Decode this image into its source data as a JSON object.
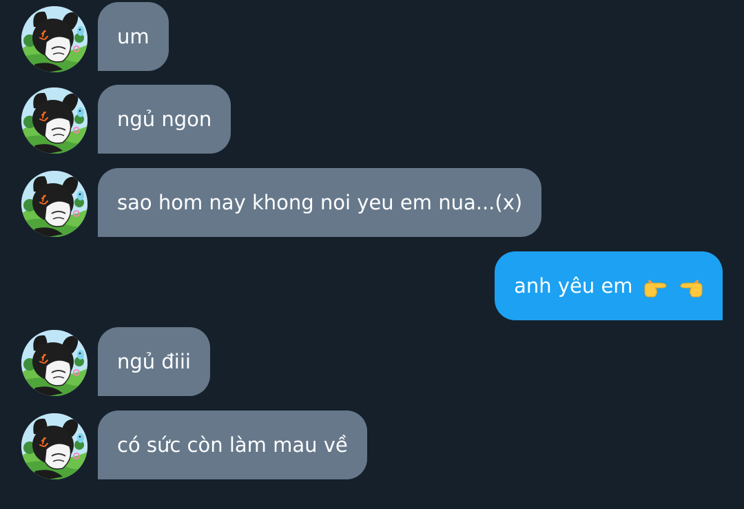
{
  "conversation": {
    "messages": [
      {
        "direction": "received",
        "text": "um"
      },
      {
        "direction": "received",
        "text": "ngủ ngon"
      },
      {
        "direction": "received",
        "text": "sao hom nay khong noi yeu em nua...(x)"
      },
      {
        "direction": "sent",
        "text": "anh yêu em",
        "emoji": [
          "pointing-right-emoji",
          "pointing-left-emoji"
        ]
      },
      {
        "direction": "received",
        "text": "ngủ điii"
      },
      {
        "direction": "received",
        "text": "có sức còn làm mau về"
      }
    ]
  },
  "colors": {
    "background": "#16202b",
    "received_bubble": "#66788a",
    "sent_bubble": "#1da1f2",
    "text": "#ffffff"
  }
}
